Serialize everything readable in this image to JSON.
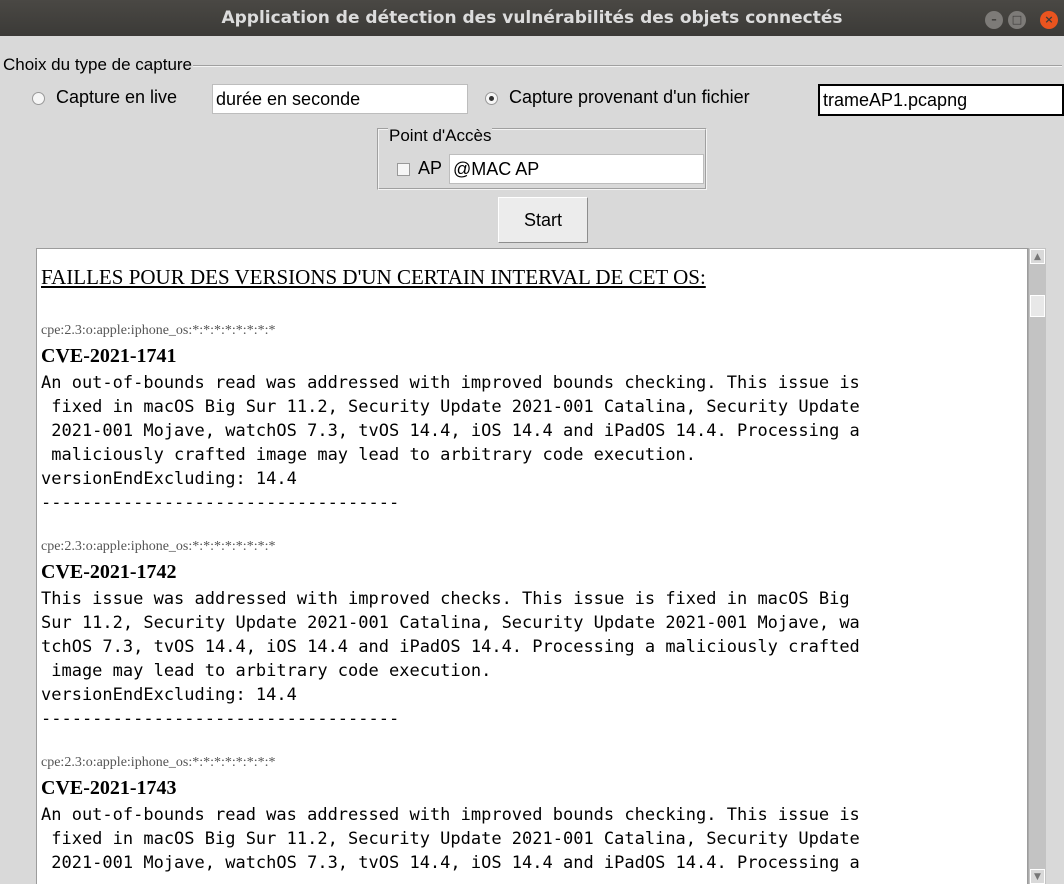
{
  "window": {
    "title": "Application de détection des vulnérabilités des objets connectés"
  },
  "capture_group": {
    "legend": "Choix du type de capture",
    "live_label": "Capture en live",
    "live_selected": false,
    "live_duration_value": "durée en seconde",
    "file_label": "Capture provenant d'un fichier",
    "file_selected": true,
    "file_value": "trameAP1.pcapng"
  },
  "ap_group": {
    "legend": "Point d'Accès",
    "checkbox_label": "AP",
    "checked": false,
    "mac_value": "@MAC AP"
  },
  "start_button": "Start",
  "results": {
    "heading": "FAILLES POUR DES VERSIONS D'UN CERTAIN INTERVAL DE CET OS:",
    "entries": [
      {
        "cpe": "cpe:2.3:o:apple:iphone_os:*:*:*:*:*:*:*:*",
        "cve": "CVE-2021-1741",
        "lines": [
          "An out-of-bounds read was addressed with improved bounds checking. This issue is",
          " fixed in macOS Big Sur 11.2, Security Update 2021-001 Catalina, Security Update",
          " 2021-001 Mojave, watchOS 7.3, tvOS 14.4, iOS 14.4 and iPadOS 14.4. Processing a",
          " maliciously crafted image may lead to arbitrary code execution.",
          "versionEndExcluding: 14.4",
          "-----------------------------------"
        ]
      },
      {
        "cpe": "cpe:2.3:o:apple:iphone_os:*:*:*:*:*:*:*:*",
        "cve": "CVE-2021-1742",
        "lines": [
          "This issue was addressed with improved checks. This issue is fixed in macOS Big",
          "Sur 11.2, Security Update 2021-001 Catalina, Security Update 2021-001 Mojave, wa",
          "tchOS 7.3, tvOS 14.4, iOS 14.4 and iPadOS 14.4. Processing a maliciously crafted",
          " image may lead to arbitrary code execution.",
          "versionEndExcluding: 14.4",
          "-----------------------------------"
        ]
      },
      {
        "cpe": "cpe:2.3:o:apple:iphone_os:*:*:*:*:*:*:*:*",
        "cve": "CVE-2021-1743",
        "lines": [
          "An out-of-bounds read was addressed with improved bounds checking. This issue is",
          " fixed in macOS Big Sur 11.2, Security Update 2021-001 Catalina, Security Update",
          " 2021-001 Mojave, watchOS 7.3, tvOS 14.4, iOS 14.4 and iPadOS 14.4. Processing a"
        ]
      }
    ]
  }
}
